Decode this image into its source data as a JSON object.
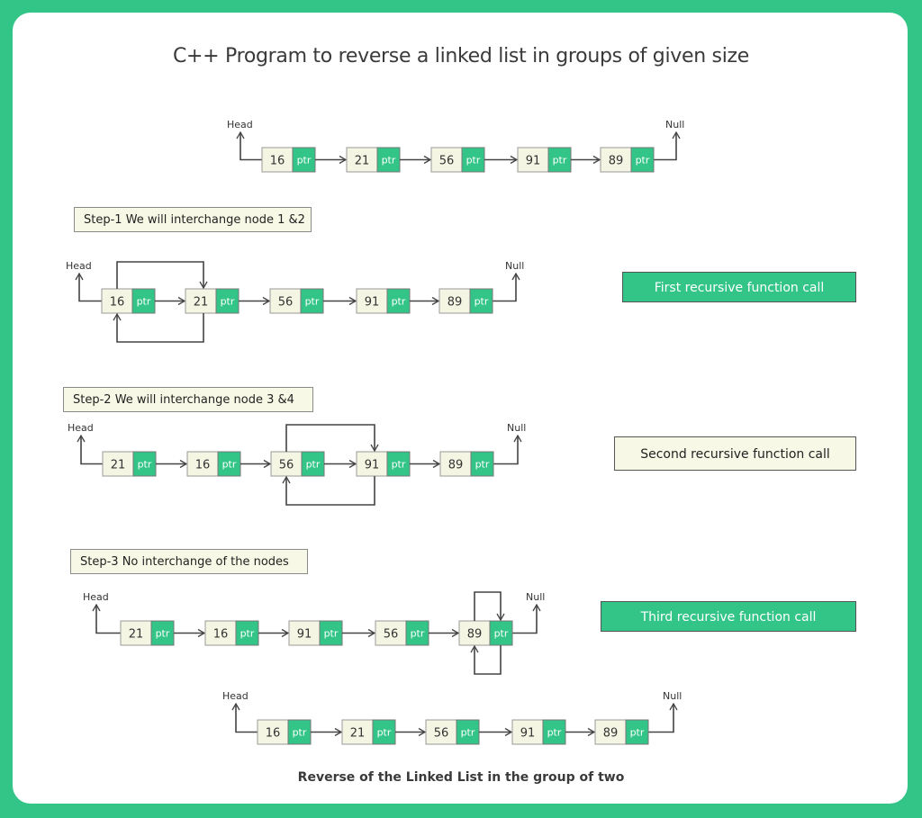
{
  "title": "C++ Program to reverse a linked list in groups of given size",
  "caption": "Reverse of the Linked List in the group of two",
  "colors": {
    "background": "#33c587",
    "node_value_fill": "#f5f5e4",
    "node_ptr_fill": "#33c587",
    "line": "#444444"
  },
  "labels": {
    "head": "Head",
    "null": "Null",
    "ptr": "ptr"
  },
  "lists": [
    {
      "id": "initial",
      "values": [
        "16",
        "21",
        "56",
        "91",
        "89"
      ],
      "swap_loop_between": null,
      "self_loop_at": null
    },
    {
      "id": "step1",
      "values": [
        "16",
        "21",
        "56",
        "91",
        "89"
      ],
      "swap_loop_between": [
        0,
        1
      ],
      "self_loop_at": null
    },
    {
      "id": "step2",
      "values": [
        "21",
        "16",
        "56",
        "91",
        "89"
      ],
      "swap_loop_between": [
        2,
        3
      ],
      "self_loop_at": null
    },
    {
      "id": "step3",
      "values": [
        "21",
        "16",
        "91",
        "56",
        "89"
      ],
      "swap_loop_between": null,
      "self_loop_at": 4
    },
    {
      "id": "final",
      "values": [
        "16",
        "21",
        "56",
        "91",
        "89"
      ],
      "swap_loop_between": null,
      "self_loop_at": null
    }
  ],
  "steps": [
    {
      "label": "Step-1  We will interchange node 1 &2"
    },
    {
      "label": "Step-2  We will interchange node 3 &4"
    },
    {
      "label": "Step-3  No interchange of the nodes"
    }
  ],
  "calls": [
    {
      "label": "First recursive function call",
      "style": "green"
    },
    {
      "label": "Second recursive function call",
      "style": "cream"
    },
    {
      "label": "Third recursive function call",
      "style": "green"
    }
  ]
}
